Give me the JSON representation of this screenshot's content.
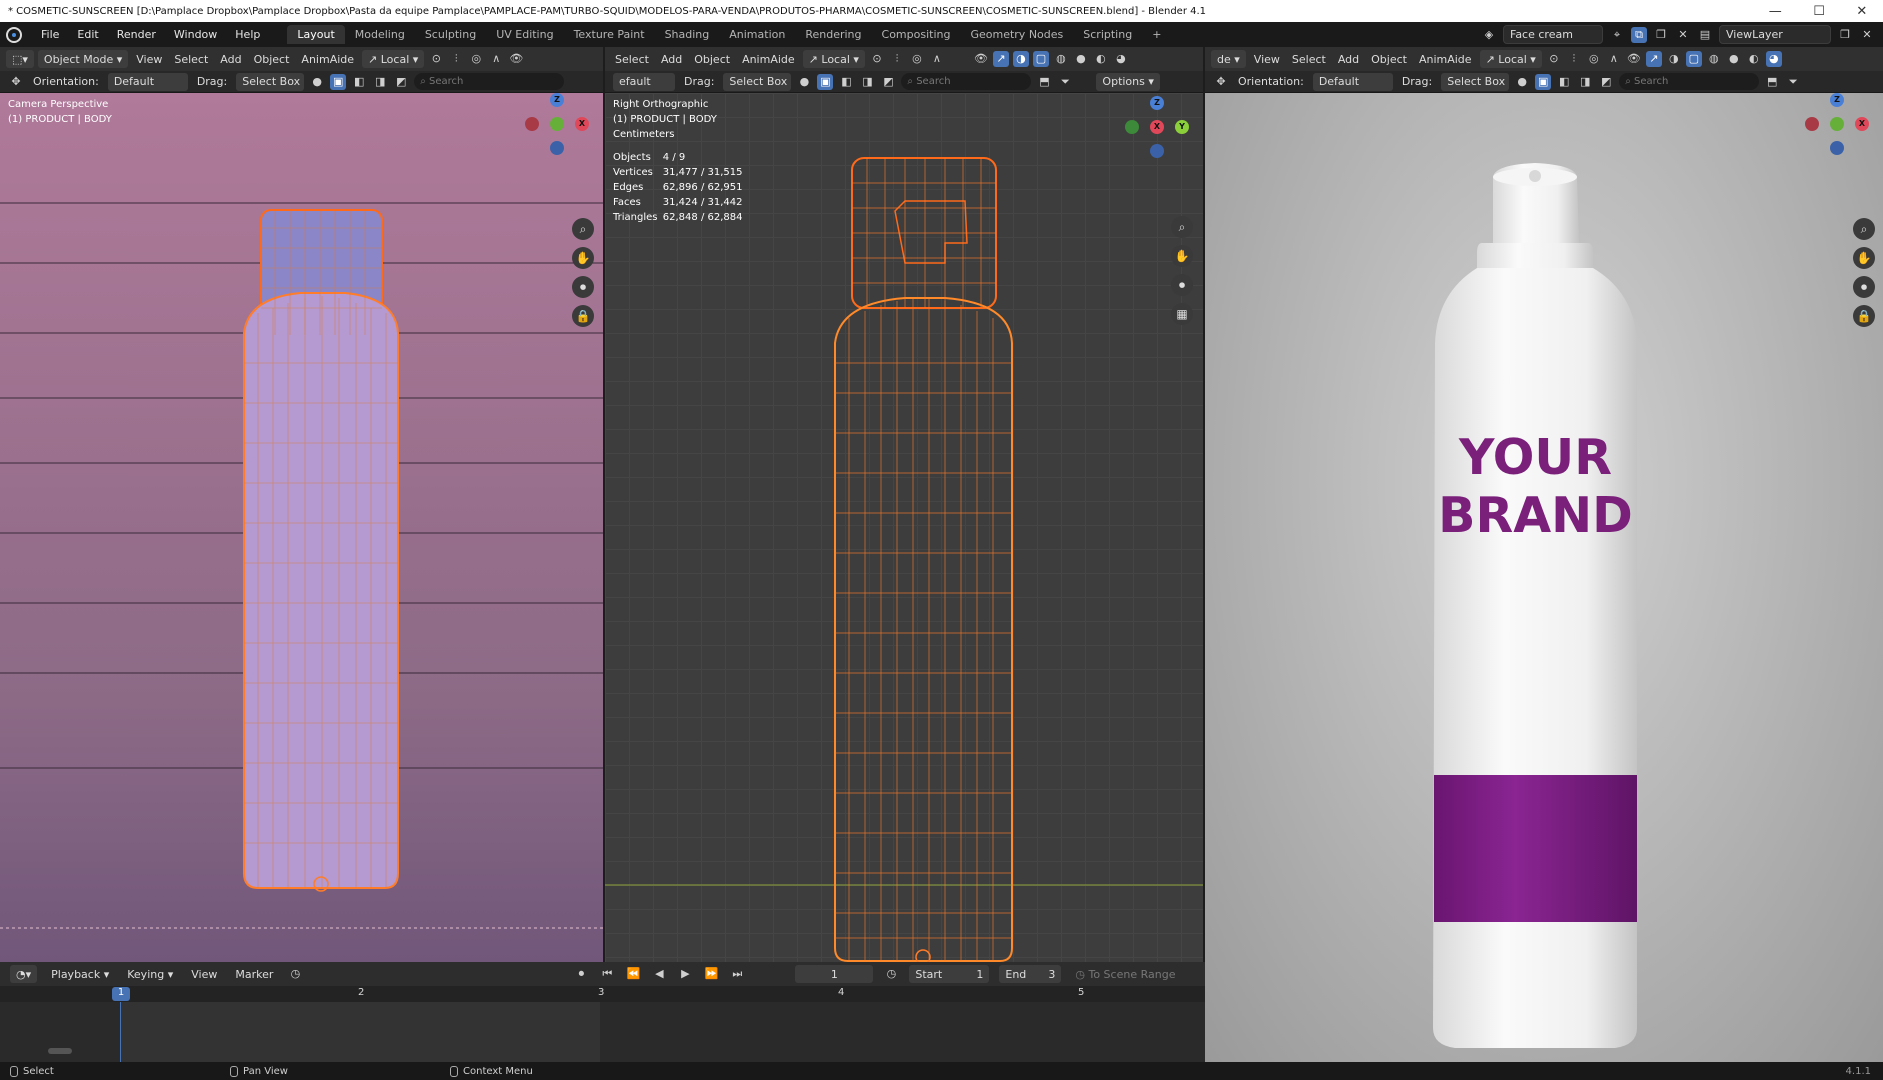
{
  "window": {
    "title": "* COSMETIC-SUNSCREEN [D:\\Pamplace Dropbox\\Pamplace Dropbox\\Pasta da equipe Pamplace\\PAMPLACE-PAM\\TURBO-SQUID\\MODELOS-PARA-VENDA\\PRODUTOS-PHARMA\\COSMETIC-SUNSCREEN\\COSMETIC-SUNSCREEN.blend] - Blender 4.1",
    "controls": [
      "—",
      "☐",
      "✕"
    ]
  },
  "menu": [
    "File",
    "Edit",
    "Render",
    "Window",
    "Help"
  ],
  "workspaces": [
    "Layout",
    "Modeling",
    "Sculpting",
    "UV Editing",
    "Texture Paint",
    "Shading",
    "Animation",
    "Rendering",
    "Compositing",
    "Geometry Nodes",
    "Scripting",
    "+"
  ],
  "top_right": {
    "scene": "Face cream",
    "view_layer": "ViewLayer"
  },
  "vp1": {
    "mode": "Object Mode",
    "menus": [
      "View",
      "Select",
      "Add",
      "Object",
      "AnimAide"
    ],
    "transform": "Local",
    "orientation_label": "Orientation:",
    "orientation": "Default",
    "drag_label": "Drag:",
    "drag": "Select Box",
    "search_placeholder": "Search",
    "overlay1": "Camera Perspective",
    "overlay2": "(1) PRODUCT | BODY"
  },
  "vp2": {
    "menus": [
      "Select",
      "Add",
      "Object",
      "AnimAide"
    ],
    "transform": "Local",
    "orientation": "efault",
    "drag_label": "Drag:",
    "drag": "Select Box",
    "search_placeholder": "Search",
    "options": "Options",
    "overlay1": "Right Orthographic",
    "overlay2": "(1) PRODUCT | BODY",
    "overlay3": "Centimeters",
    "stats": [
      {
        "k": "Objects",
        "v": "4 / 9"
      },
      {
        "k": "Vertices",
        "v": "31,477 / 31,515"
      },
      {
        "k": "Edges",
        "v": "62,896 / 62,951"
      },
      {
        "k": "Faces",
        "v": "31,424 / 31,442"
      },
      {
        "k": "Triangles",
        "v": "62,848 / 62,884"
      }
    ]
  },
  "vp3": {
    "mode_fragment": "de",
    "menus": [
      "View",
      "Select",
      "Add",
      "Object",
      "AnimAide"
    ],
    "transform": "Local",
    "orientation_label": "Orientation:",
    "orientation": "Default",
    "drag_label": "Drag:",
    "drag": "Select Box",
    "search_placeholder": "Search",
    "label_line1": "YOUR",
    "label_line2": "BRAND",
    "brand_color": "#7a1f7a",
    "band_color": "#7c1e86"
  },
  "timeline": {
    "menus": [
      "Playback",
      "Keying",
      "View",
      "Marker"
    ],
    "current_frame": "1",
    "start_label": "Start",
    "start": "1",
    "end_label": "End",
    "end": "3",
    "range": "To Scene Range",
    "ticks": [
      "1",
      "2",
      "3",
      "4",
      "5"
    ]
  },
  "status": {
    "select": "Select",
    "pan": "Pan View",
    "context": "Context Menu",
    "version": "4.1.1"
  },
  "axes": {
    "x": "X",
    "y": "Y",
    "z": "Z"
  },
  "icons": {
    "zoom": "⌕",
    "hand": "✋",
    "camera": "⏺",
    "lock": "🔒",
    "grid": "▦"
  }
}
